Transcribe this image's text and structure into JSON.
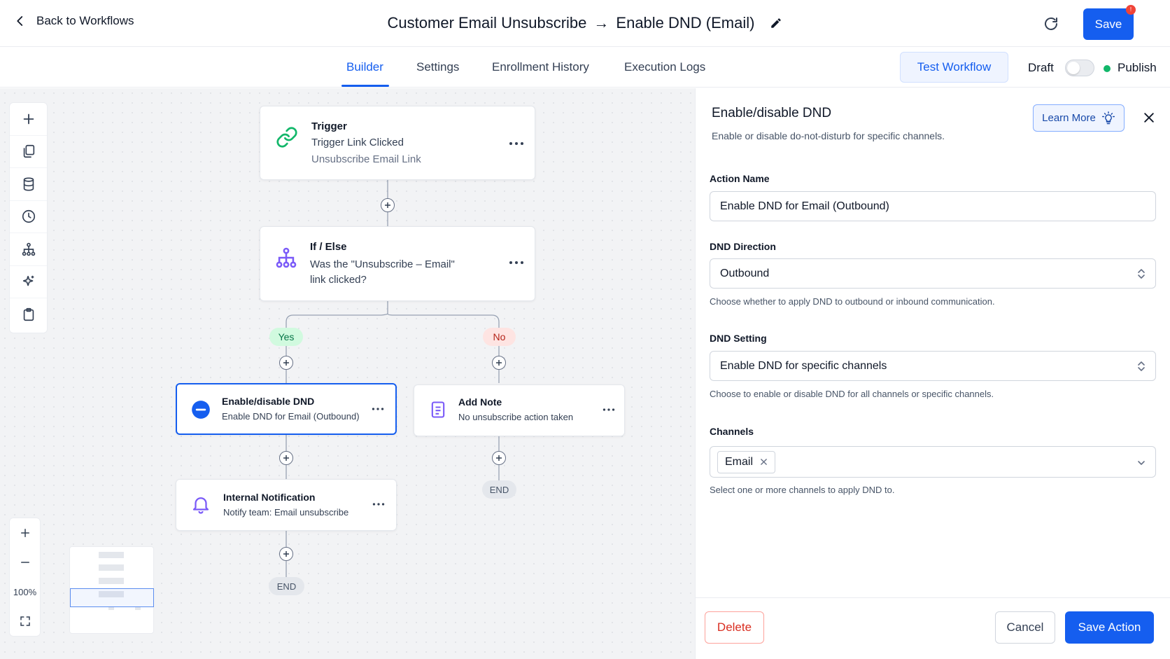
{
  "header": {
    "back_label": "Back to Workflows",
    "title_left": "Customer Email Unsubscribe",
    "title_arrow": "→",
    "title_right": "Enable DND (Email)",
    "save_label": "Save",
    "save_badge": "!"
  },
  "tabs": [
    {
      "label": "Builder",
      "active": true
    },
    {
      "label": "Settings",
      "active": false
    },
    {
      "label": "Enrollment History",
      "active": false
    },
    {
      "label": "Execution Logs",
      "active": false
    }
  ],
  "top_actions": {
    "test_label": "Test Workflow",
    "draft_label": "Draft",
    "publish_label": "Publish",
    "publish_toggle_on": false
  },
  "canvas": {
    "zoom_level": "100%",
    "nodes": {
      "trigger": {
        "title": "Trigger",
        "subtitle": "Trigger Link Clicked",
        "detail": "Unsubscribe Email Link"
      },
      "if_else": {
        "title": "If / Else",
        "line1": "Was the \"Unsubscribe – Email\"",
        "line2": "link clicked?"
      },
      "dnd": {
        "title": "Enable/disable DND",
        "subtitle": "Enable DND for Email (Outbound)"
      },
      "add_note": {
        "title": "Add Note",
        "subtitle": "No unsubscribe action taken"
      },
      "notification": {
        "title": "Internal Notification",
        "subtitle": "Notify team: Email unsubscribe"
      }
    },
    "branches": {
      "yes": "Yes",
      "no": "No"
    },
    "end_label": "END"
  },
  "panel": {
    "title": "Enable/disable DND",
    "description": "Enable or disable do-not-disturb for specific channels.",
    "learn_more": "Learn More",
    "fields": {
      "action_name": {
        "label": "Action Name",
        "value": "Enable DND for Email (Outbound)"
      },
      "direction": {
        "label": "DND Direction",
        "value": "Outbound",
        "help": "Choose whether to apply DND to outbound or inbound communication."
      },
      "setting": {
        "label": "DND Setting",
        "value": "Enable DND for specific channels",
        "help": "Choose to enable or disable DND for all channels or specific channels."
      },
      "channels": {
        "label": "Channels",
        "chips": [
          "Email"
        ],
        "help": "Select one or more channels to apply DND to."
      }
    },
    "footer": {
      "delete": "Delete",
      "cancel": "Cancel",
      "save": "Save Action"
    }
  },
  "colors": {
    "primary": "#155eef",
    "yes_bg": "#d1fadf",
    "no_bg": "#fee4e2",
    "publish_dot": "#12b76a",
    "danger": "#d92d20",
    "trigger_icon": "#12b76a",
    "purple_icon": "#7a5af8"
  }
}
